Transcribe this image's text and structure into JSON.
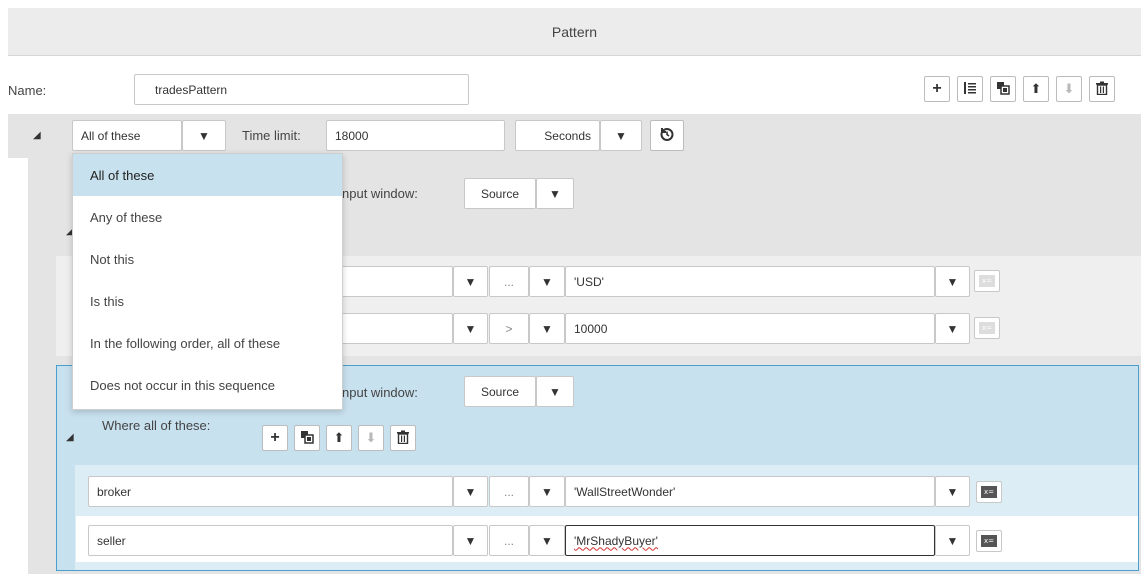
{
  "header": {
    "title": "Pattern"
  },
  "name_row": {
    "label": "Name:",
    "value": "tradesPattern"
  },
  "toolbar": [
    "add-icon",
    "list-icon",
    "copy-icon",
    "move-up-icon",
    "move-down-icon",
    "delete-icon"
  ],
  "top_row": {
    "operator_value": "All of these",
    "time_limit_label": "Time limit:",
    "time_limit_value": "18000",
    "unit_value": "Seconds"
  },
  "dropdown": {
    "options": [
      "All of these",
      "Any of these",
      "Not this",
      "Is this",
      "In the following order, all of these",
      "Does not occur in this sequence"
    ],
    "selected_index": 0
  },
  "group1": {
    "input_window_label": "nput window:",
    "input_window_value": "Source",
    "conditions": [
      {
        "field": "",
        "operator": "...",
        "value": "'USD'"
      },
      {
        "field": "",
        "operator": ">",
        "value": "10000"
      }
    ]
  },
  "group2": {
    "input_window_label": "nput window:",
    "input_window_value": "Source",
    "where_label": "Where all of these:",
    "conditions": [
      {
        "field": "broker",
        "operator": "...",
        "value": "'WallStreetWonder'"
      },
      {
        "field": "seller",
        "operator": "...",
        "value": "'MrShadyBuyer'"
      }
    ]
  },
  "glyphs": {
    "arrow": "▼",
    "tri": "◢",
    "plus": "+",
    "up": "⬆",
    "down": "⬇",
    "trash": "🗑",
    "timer": "⟳"
  },
  "colors": {
    "selection": "#c8e1ef",
    "group_active": "#c8e1ef",
    "group_border": "#4a9fcf"
  }
}
